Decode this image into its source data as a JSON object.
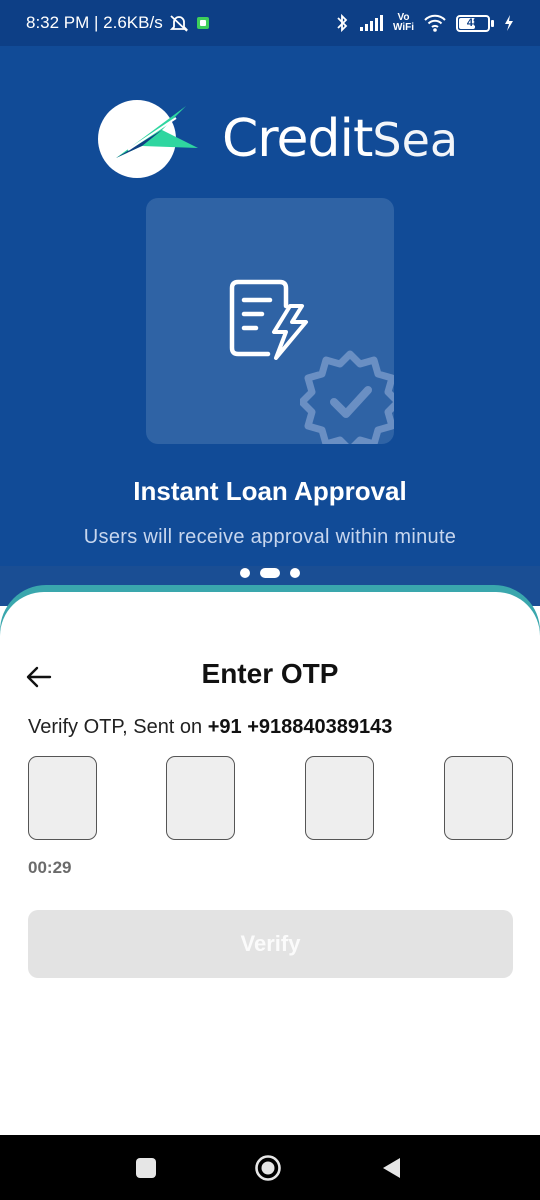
{
  "status_bar": {
    "time_speed": "8:32 PM | 2.6KB/s",
    "vowifi_top": "Vo",
    "vowifi_bottom": "WiFi",
    "battery": "48",
    "icons": [
      "alarm-off-icon",
      "app-notification-icon",
      "bluetooth-icon",
      "signal-icon",
      "wifi-icon",
      "battery-icon",
      "charging-icon"
    ]
  },
  "hero": {
    "brand_main": "Credit",
    "brand_secondary": "Sea",
    "title": "Instant Loan Approval",
    "subtitle": "Users will receive approval within minute",
    "carousel": {
      "count": 3,
      "active_index": 1
    },
    "icons": [
      "document-lightning-icon",
      "verified-badge-icon"
    ]
  },
  "otp_sheet": {
    "title": "Enter OTP",
    "verify_prefix": "Verify OTP, Sent on ",
    "phone": "+91 +918840389143",
    "otp_digits": [
      "",
      "",
      "",
      ""
    ],
    "timer": "00:29",
    "verify_button": "Verify"
  },
  "nav_bar": {
    "icons": [
      "recents-square-icon",
      "home-circle-icon",
      "back-triangle-icon"
    ]
  },
  "colors": {
    "hero_bg": "#114b97",
    "status_bg": "#0d3f86",
    "accent_teal": "#3aa7ad",
    "button_disabled": "#e3e3e3",
    "logo_green": "#2fd6a0"
  }
}
